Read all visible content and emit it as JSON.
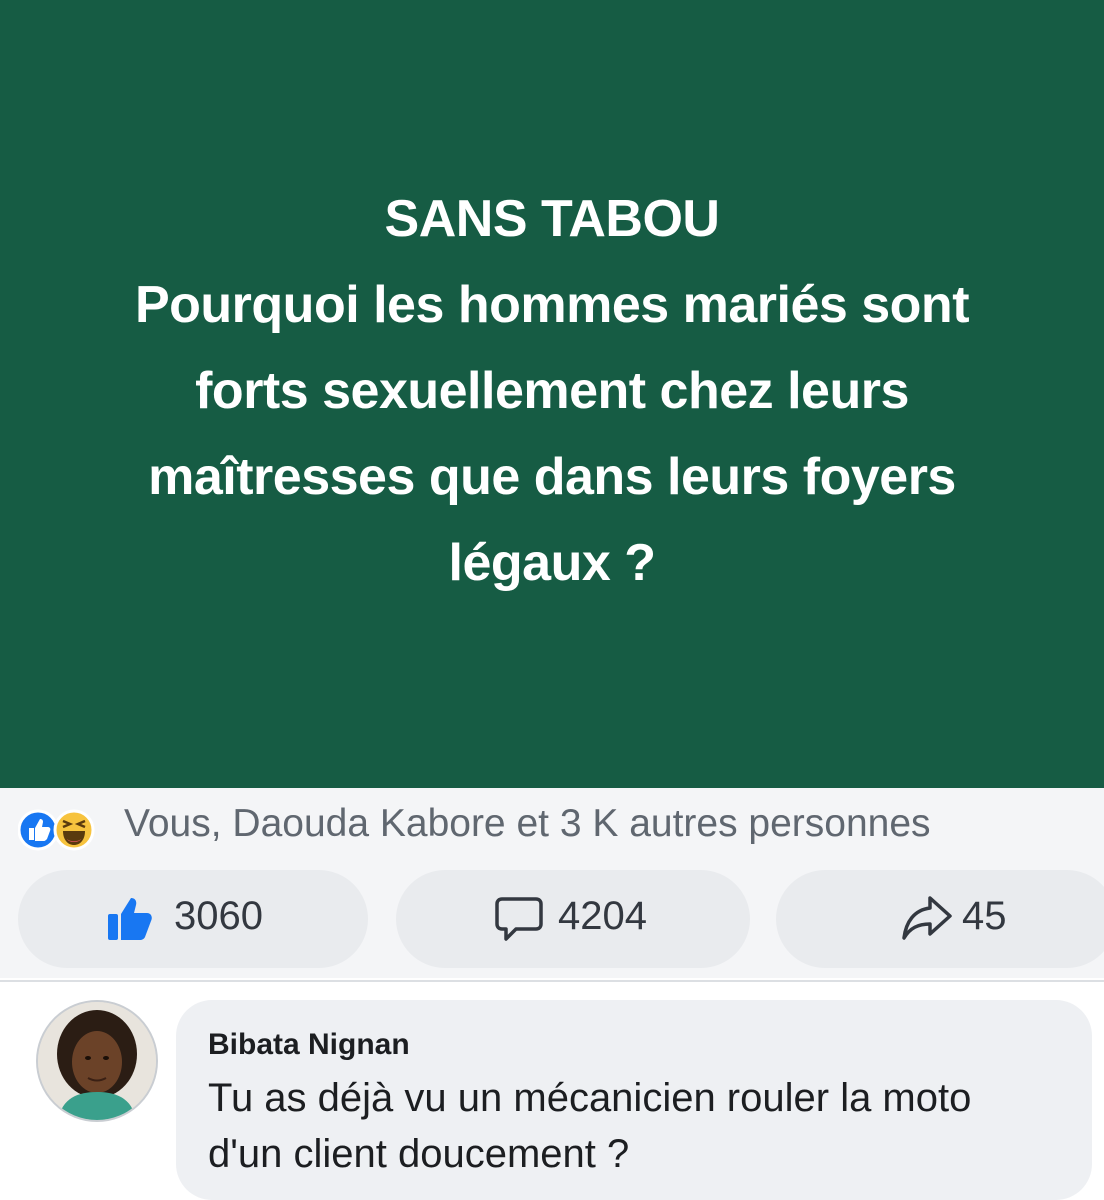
{
  "post": {
    "background_color": "#165c44",
    "title_lines": [
      "SANS TABOU",
      "Pourquoi les hommes mariés sont",
      "forts sexuellement chez leurs",
      "maîtresses que dans leurs foyers",
      "légaux ?"
    ]
  },
  "reactions": {
    "icons": [
      "like-reaction-icon",
      "haha-reaction-icon"
    ],
    "summary": "Vous, Daouda Kabore et 3 K autres personnes"
  },
  "actions": {
    "like": {
      "icon": "thumbs-up-icon",
      "count": "3060"
    },
    "comment": {
      "icon": "speech-bubble-icon",
      "count": "4204"
    },
    "share": {
      "icon": "share-arrow-icon",
      "count": "45"
    }
  },
  "comment": {
    "author": "Bibata Nignan",
    "text_lines": [
      "Tu as déjà vu un mécanicien rouler la moto",
      "d'un client doucement ?"
    ]
  },
  "colors": {
    "accent_blue": "#1877f2",
    "haha_yellow": "#f7c33e"
  }
}
